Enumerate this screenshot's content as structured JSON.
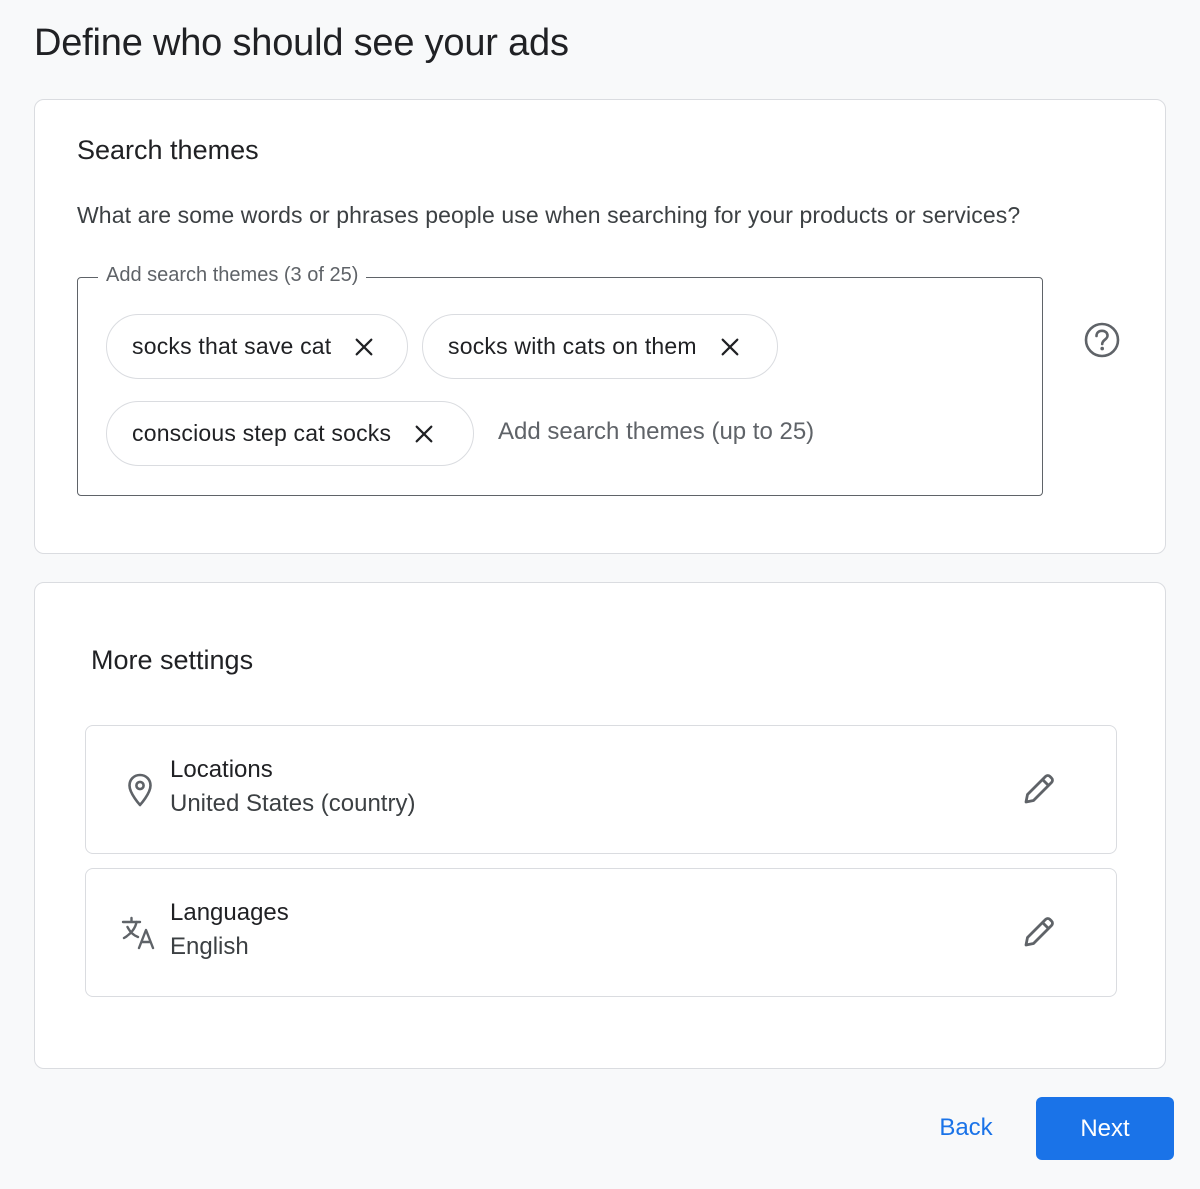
{
  "page": {
    "title": "Define who should see your ads"
  },
  "search_themes": {
    "title": "Search themes",
    "description": "What are some words or phrases people use when searching for your products or services?",
    "field_label": "Add search themes (3 of 25)",
    "input_value": "",
    "input_placeholder": "Add search themes (up to 25)",
    "chips": [
      {
        "label": "socks that save cat"
      },
      {
        "label": "socks with cats on them"
      },
      {
        "label": "conscious step cat socks"
      }
    ],
    "help_icon": "help-circle-icon"
  },
  "more_settings": {
    "title": "More settings",
    "rows": [
      {
        "title": "Locations",
        "value": "United States (country)",
        "icon": "location-pin-icon"
      },
      {
        "title": "Languages",
        "value": "English",
        "icon": "translate-icon"
      }
    ]
  },
  "footer": {
    "back_label": "Back",
    "next_label": "Next"
  },
  "colors": {
    "accent": "#1a73e8",
    "border": "#dadce0",
    "text": "#202124",
    "background": "#f8f9fa"
  }
}
